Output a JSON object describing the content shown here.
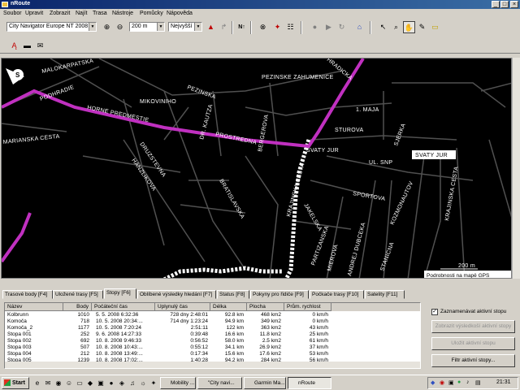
{
  "window": {
    "title": "nRoute"
  },
  "menu": [
    "Soubor",
    "Upravit",
    "Zobrazit",
    "Najít",
    "Trasa",
    "Nástroje",
    "Pomůcky",
    "Nápověda"
  ],
  "toolbar": {
    "map_select": "City Navigator Europe NT 2008",
    "zoom_select": "200 m",
    "route_pref": "Nejvyšší"
  },
  "map": {
    "labels": {
      "malokarpatska": "MALOKARPATSKA",
      "podhradie": "PODHRADIE",
      "horne_predmestie": "HORNE PREDMESTIE",
      "marianska": "MARIANSKA CESTA",
      "mikovniho": "MIKOVINIHO",
      "pezinska": "PEZINSKA",
      "pezinske_zahumenice": "PEZINSKE ZAHUMENICE",
      "hradicka": "HRADICKA",
      "maja": "1. MAJA",
      "sturova": "STUROVA",
      "dr_kautza": "DR. KAUTZA",
      "prostredna": "PROSTREDNA",
      "bergerova": "BERGEROVA",
      "svaty_jur": "SVATY JUR",
      "svaty_jur_box": "SVATY JUR",
      "druzstevna": "DRUZSTEVNA",
      "hanzlikova": "HANZLIKOVA",
      "bratislavska": "BRATISLAVSKA",
      "krajinska": "KRAJINSKA CESTA",
      "krajinska2": "KRAJINSKA CESTA",
      "ul_snp": "UL. SNP",
      "sportova": "SPORTOVA",
      "sverkova": "SJERKA",
      "kozmonautov": "KOZMONAUTOV",
      "akelska": "JAKELSKA",
      "partizanska": "PARTIZANSKA",
      "mierova": "MIEROVA",
      "andrej": "ANDREJ DUBCEKA",
      "stanicna": "STANICNA",
      "scale": "200 m",
      "details": "Podrobnosti na mapě GPS"
    }
  },
  "tabs": [
    {
      "label": "Trasové body [F4]"
    },
    {
      "label": "Uložené trasy [F5]"
    },
    {
      "label": "Stopy [F6]"
    },
    {
      "label": "Oblíbené výsledky hledání [F7]"
    },
    {
      "label": "Status [F8]"
    },
    {
      "label": "Pokyny pro řidiče [F9]"
    },
    {
      "label": "Počkače trasy [F10]"
    },
    {
      "label": "Satelity [F11]"
    }
  ],
  "tracks": {
    "columns": [
      "Název",
      "Body",
      "Počáteční čas",
      "Uplynulý čas",
      "Délka",
      "Plocha",
      "Prům. rychlost"
    ],
    "rows": [
      [
        "Kolbrunn",
        "1010",
        "5. 5. 2008 6:32:36",
        "728 dny 2:48:01",
        "92.8 km",
        "468 km2",
        "0 km/h"
      ],
      [
        "Komoča",
        "718",
        "10. 5. 2008 20:34:...",
        "714 dny 1:23:24",
        "94.9 km",
        "349 km2",
        "0 km/h"
      ],
      [
        "Komoča_2",
        "1177",
        "10. 5. 2008 7:20:24",
        "2:51:11",
        "122 km",
        "363 km2",
        "43 km/h"
      ],
      [
        "Stopa 001",
        "252",
        "9. 6. 2008 14:27:33",
        "0:39:48",
        "16.6 km",
        "11.8 km2",
        "25 km/h"
      ],
      [
        "Stopa 002",
        "692",
        "10. 8. 2008 9:46:33",
        "0:56:52",
        "58.0 km",
        "2.5 km2",
        "61 km/h"
      ],
      [
        "Stopa 003",
        "507",
        "10. 8. 2008 10:43:...",
        "0:55:12",
        "34.1 km",
        "26.9 km2",
        "37 km/h"
      ],
      [
        "Stopa 004",
        "212",
        "10. 8. 2008 13:49:...",
        "0:17:34",
        "15.6 km",
        "17.6 km2",
        "53 km/h"
      ],
      [
        "Stopa 005",
        "1239",
        "10. 8. 2008 17:02:...",
        "1:40:28",
        "94.2 km",
        "284 km2",
        "56 km/h"
      ]
    ]
  },
  "panel": {
    "checkbox_label": "Zaznamenávat aktivní stopu",
    "btn_show": "Zobrazit výsledkoší aktivní stopy",
    "btn_save": "Uložit aktivní stopu",
    "btn_filter": "Filtr aktivní stopy..."
  },
  "taskbar": {
    "start": "Start",
    "items": [
      "Mobility ...",
      "\"City navi...",
      "Garmin Ma...",
      "nRoute"
    ],
    "clock": "21:31"
  },
  "colors": {
    "route": "#c030c0",
    "track": "#ffffff",
    "title_start": "#0a246a",
    "title_end": "#3a6ea5"
  }
}
